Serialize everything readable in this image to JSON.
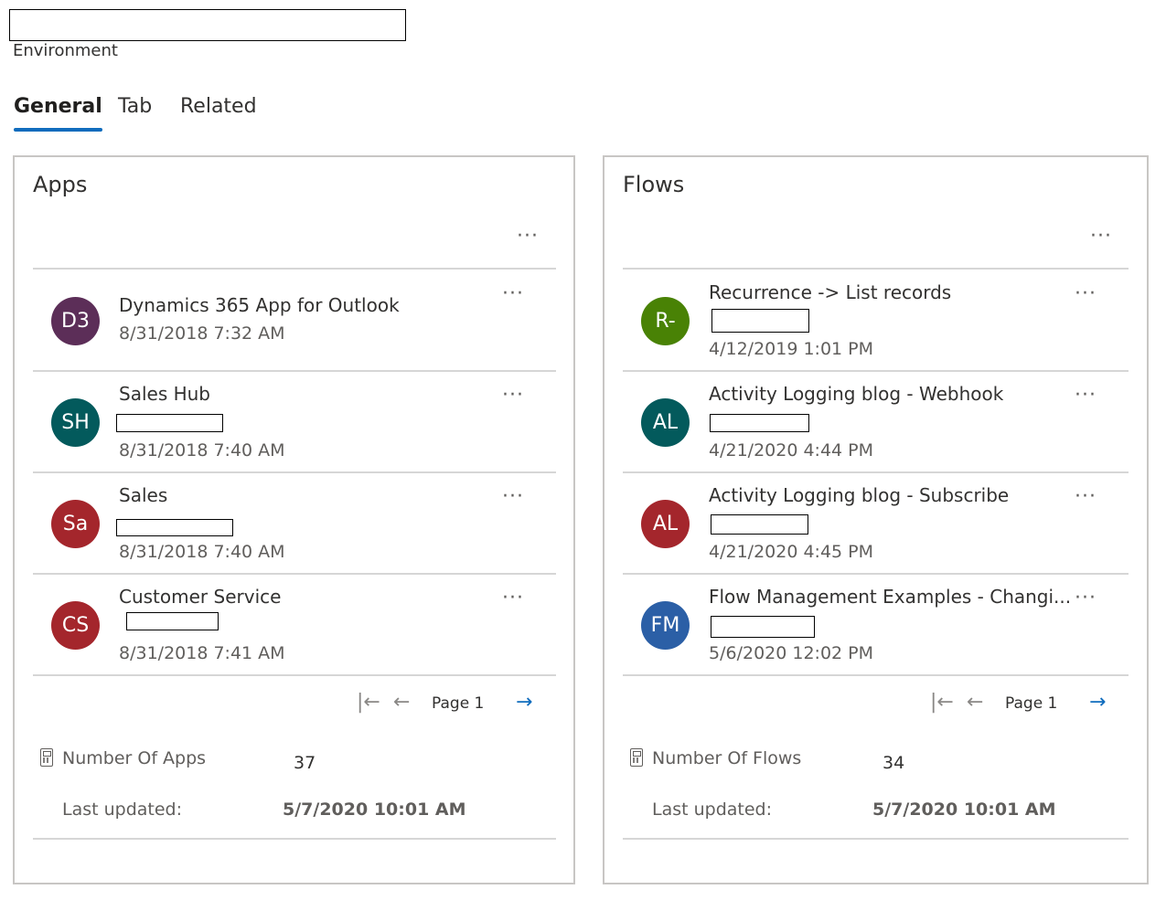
{
  "header": {
    "environment_label": "Environment"
  },
  "tabs": [
    {
      "label": "General",
      "active": true
    },
    {
      "label": "Tab",
      "active": false
    },
    {
      "label": "Related",
      "active": false
    }
  ],
  "apps_panel": {
    "title": "Apps",
    "more_label": "...",
    "rows": [
      {
        "initials": "D3",
        "color": "#5c2e58",
        "title": "Dynamics 365 App for Outlook",
        "date": "8/31/2018 7:32 AM"
      },
      {
        "initials": "SH",
        "color": "#035a5c",
        "title": "Sales Hub",
        "date": "8/31/2018 7:40 AM"
      },
      {
        "initials": "Sa",
        "color": "#a4262c",
        "title": "Sales",
        "date": "8/31/2018 7:40 AM"
      },
      {
        "initials": "CS",
        "color": "#a4262c",
        "title": "Customer Service",
        "date": "8/31/2018 7:41 AM"
      }
    ],
    "pager": {
      "page_label": "Page 1",
      "first_icon": "first-page-icon",
      "prev_icon": "arrow-left-icon",
      "next_icon": "arrow-right-icon"
    },
    "metric_label": "Number Of Apps",
    "metric_value": "37",
    "updated_label": "Last updated:",
    "updated_value": "5/7/2020 10:01 AM"
  },
  "flows_panel": {
    "title": "Flows",
    "more_label": "...",
    "rows": [
      {
        "initials": "R-",
        "color": "#498205",
        "title": "Recurrence -> List records",
        "date": "4/12/2019 1:01 PM"
      },
      {
        "initials": "AL",
        "color": "#035a5c",
        "title": "Activity Logging blog - Webhook",
        "date": "4/21/2020 4:44 PM"
      },
      {
        "initials": "AL",
        "color": "#a4262c",
        "title": "Activity Logging blog - Subscribe",
        "date": "4/21/2020 4:45 PM"
      },
      {
        "initials": "FM",
        "color": "#2b5fa6",
        "title": "Flow Management Examples - Changi...",
        "date": "5/6/2020 12:02 PM"
      }
    ],
    "pager": {
      "page_label": "Page 1",
      "first_icon": "first-page-icon",
      "prev_icon": "arrow-left-icon",
      "next_icon": "arrow-right-icon"
    },
    "metric_label": "Number Of Flows",
    "metric_value": "34",
    "updated_label": "Last updated:",
    "updated_value": "5/7/2020 10:01 AM"
  },
  "icons": {
    "more": "ellipsis-icon",
    "metric": "calculator-icon"
  },
  "colors": {
    "accent": "#0f6cbd"
  }
}
